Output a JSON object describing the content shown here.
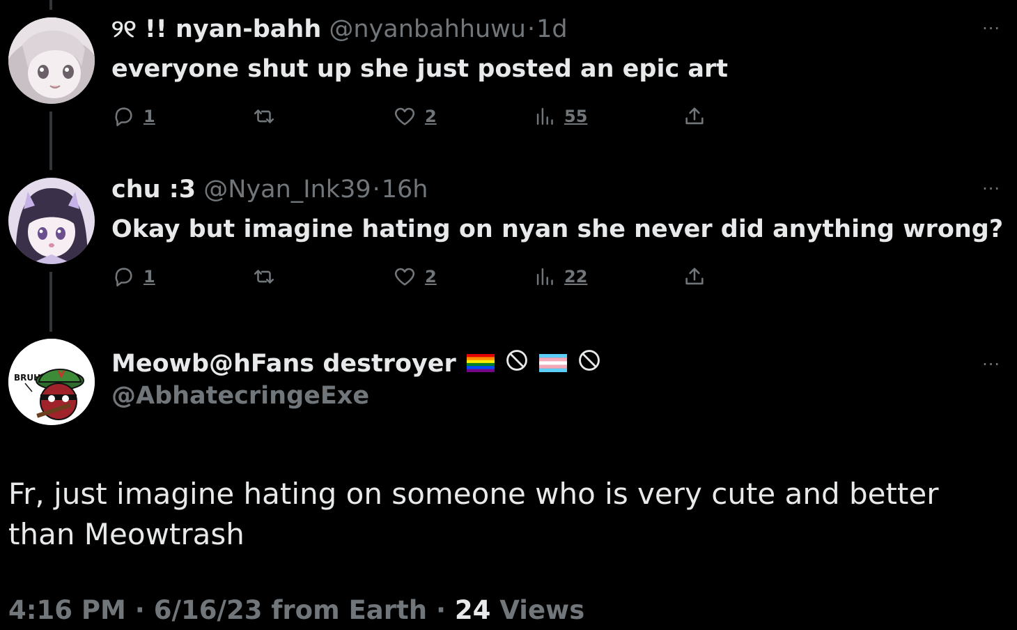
{
  "tweets": [
    {
      "display_name": "୨୧ !! nyan-bahh",
      "handle": "@nyanbahhuwu",
      "separator": "·",
      "time": "1d",
      "text": "everyone shut up she just posted an epic art",
      "more": "···",
      "replies": "1",
      "likes": "2",
      "views": "55"
    },
    {
      "display_name": "chu :3",
      "handle": "@Nyan_Ink39",
      "separator": "·",
      "time": "16h",
      "text": "Okay but imagine hating on nyan she never did anything wrong?",
      "more": "···",
      "replies": "1",
      "likes": "2",
      "views": "22"
    }
  ],
  "main_tweet": {
    "display_name": "Meowb@hFans destroyer",
    "handle": "@AbhatecringeExe",
    "avatar_text": "BRUH...",
    "more": "···",
    "text": "Fr, just imagine hating on someone who is very cute and better than Meowtrash",
    "footer_time": "4:16 PM",
    "footer_sep": "·",
    "footer_date": "6/16/23 from Earth",
    "footer_sep2": "·",
    "views_count": "24",
    "views_label": "Views"
  },
  "icons": {
    "reply": "reply-icon",
    "retweet": "retweet-icon",
    "like": "heart-icon",
    "views": "views-icon",
    "share": "share-icon",
    "rainbow_flag": "rainbow-flag-icon",
    "trans_flag": "transgender-flag-icon",
    "prohibited": "prohibited-icon"
  },
  "colors": {
    "background": "#000000",
    "text_primary": "#e7e9ea",
    "text_secondary": "#71767b",
    "thread_line": "#333639"
  }
}
